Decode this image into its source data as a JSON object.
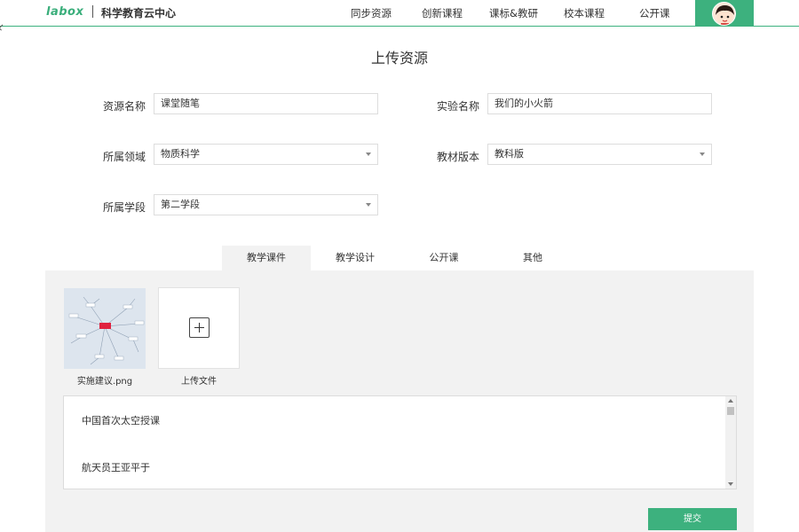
{
  "colors": {
    "accent": "#3db17e",
    "panel_bg": "#f2f2f2"
  },
  "header": {
    "logo": "labox",
    "site_title": "科学教育云中心",
    "nav": [
      "同步资源",
      "创新课程",
      "课标&教研",
      "校本课程",
      "公开课"
    ],
    "avatar_icon": "cartoon-girl-avatar"
  },
  "page_title": "上传资源",
  "form": {
    "resource_name": {
      "label": "资源名称",
      "value": "课堂随笔"
    },
    "experiment_name": {
      "label": "实验名称",
      "value": "我们的小火箭"
    },
    "domain": {
      "label": "所属领域",
      "value": "物质科学"
    },
    "textbook_version": {
      "label": "教材版本",
      "value": "教科版"
    },
    "stage": {
      "label": "所属学段",
      "value": "第二学段"
    }
  },
  "tabs": [
    {
      "label": "教学课件",
      "active": true
    },
    {
      "label": "教学设计",
      "active": false
    },
    {
      "label": "公开课",
      "active": false
    },
    {
      "label": "其他",
      "active": false
    }
  ],
  "files": [
    {
      "name": "实施建议.png"
    }
  ],
  "upload_label": "上传文件",
  "description_lines": [
    "中国首次太空授课",
    "航天员王亚平于"
  ],
  "submit_label": "提交"
}
